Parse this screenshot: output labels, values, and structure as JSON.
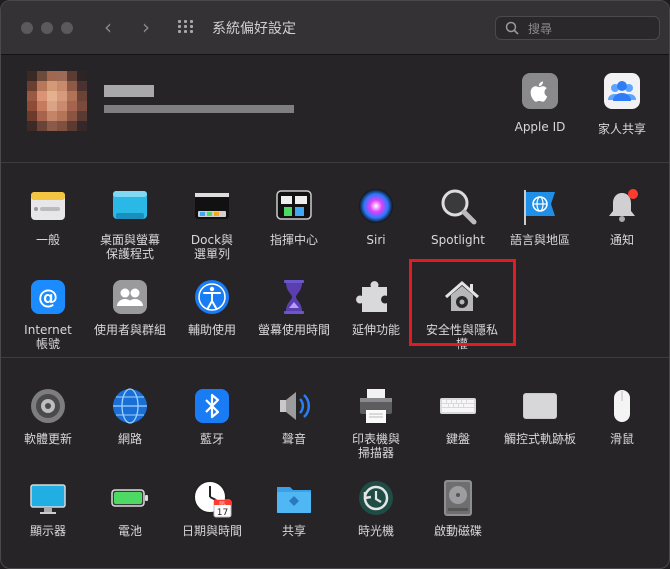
{
  "window": {
    "title": "系統偏好設定"
  },
  "search": {
    "placeholder": "搜尋"
  },
  "account": {
    "apple_id_label": "Apple ID",
    "family_label": "家人共享"
  },
  "row1": [
    {
      "label": "一般",
      "icon": "general-icon"
    },
    {
      "label": "桌面與螢幕\n保護程式",
      "icon": "desktop-icon"
    },
    {
      "label": "Dock與\n選單列",
      "icon": "dock-icon"
    },
    {
      "label": "指揮中心",
      "icon": "mission-control-icon"
    },
    {
      "label": "Siri",
      "icon": "siri-icon"
    },
    {
      "label": "Spotlight",
      "icon": "spotlight-icon"
    },
    {
      "label": "語言與地區",
      "icon": "language-icon"
    },
    {
      "label": "通知",
      "icon": "notifications-icon"
    }
  ],
  "row2": [
    {
      "label": "Internet\n帳號",
      "icon": "internet-accounts-icon"
    },
    {
      "label": "使用者與群組",
      "icon": "users-icon"
    },
    {
      "label": "輔助使用",
      "icon": "accessibility-icon"
    },
    {
      "label": "螢幕使用時間",
      "icon": "screen-time-icon"
    },
    {
      "label": "延伸功能",
      "icon": "extensions-icon"
    },
    {
      "label": "安全性與隱私權",
      "icon": "security-icon"
    }
  ],
  "row3": [
    {
      "label": "軟體更新",
      "icon": "software-update-icon"
    },
    {
      "label": "網路",
      "icon": "network-icon"
    },
    {
      "label": "藍牙",
      "icon": "bluetooth-icon"
    },
    {
      "label": "聲音",
      "icon": "sound-icon"
    },
    {
      "label": "印表機與\n掃描器",
      "icon": "printer-icon"
    },
    {
      "label": "鍵盤",
      "icon": "keyboard-icon"
    },
    {
      "label": "觸控式軌跡板",
      "icon": "trackpad-icon"
    },
    {
      "label": "滑鼠",
      "icon": "mouse-icon"
    }
  ],
  "row4": [
    {
      "label": "顯示器",
      "icon": "display-icon"
    },
    {
      "label": "電池",
      "icon": "battery-icon"
    },
    {
      "label": "日期與時間",
      "icon": "date-time-icon"
    },
    {
      "label": "共享",
      "icon": "sharing-icon"
    },
    {
      "label": "時光機",
      "icon": "time-machine-icon"
    },
    {
      "label": "啟動磁碟",
      "icon": "startup-disk-icon"
    }
  ],
  "calendar_day": "17",
  "calendar_month": "JUL",
  "colors": {
    "highlight": "#e01b24",
    "accent": "#1a7cf5"
  }
}
